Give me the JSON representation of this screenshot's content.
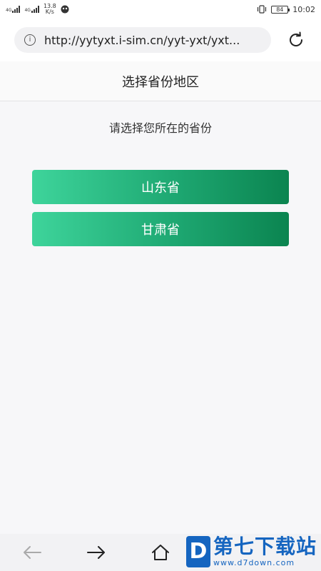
{
  "status_bar": {
    "network_1": "4G",
    "network_2": "4G",
    "speed": "13.8",
    "speed_unit": "K/s",
    "battery": "84",
    "time": "10:02"
  },
  "browser": {
    "url": "http://yytyxt.i-sim.cn/yyt-yxt/yxt...",
    "info_icon": "info-icon",
    "reload_icon": "reload-icon"
  },
  "page": {
    "title": "选择省份地区",
    "prompt": "请选择您所在的省份",
    "provinces": [
      {
        "label": "山东省"
      },
      {
        "label": "甘肃省"
      }
    ]
  },
  "nav_bar": {
    "icons": [
      "back-arrow-icon",
      "forward-arrow-icon",
      "home-icon"
    ]
  },
  "watermark": {
    "logo_letter": "D",
    "title": "第七下载站",
    "site": "www.d7down.com"
  },
  "colors": {
    "button_gradient_start": "#3ed49b",
    "button_gradient_end": "#0b8450",
    "watermark_blue": "#1565c0"
  }
}
